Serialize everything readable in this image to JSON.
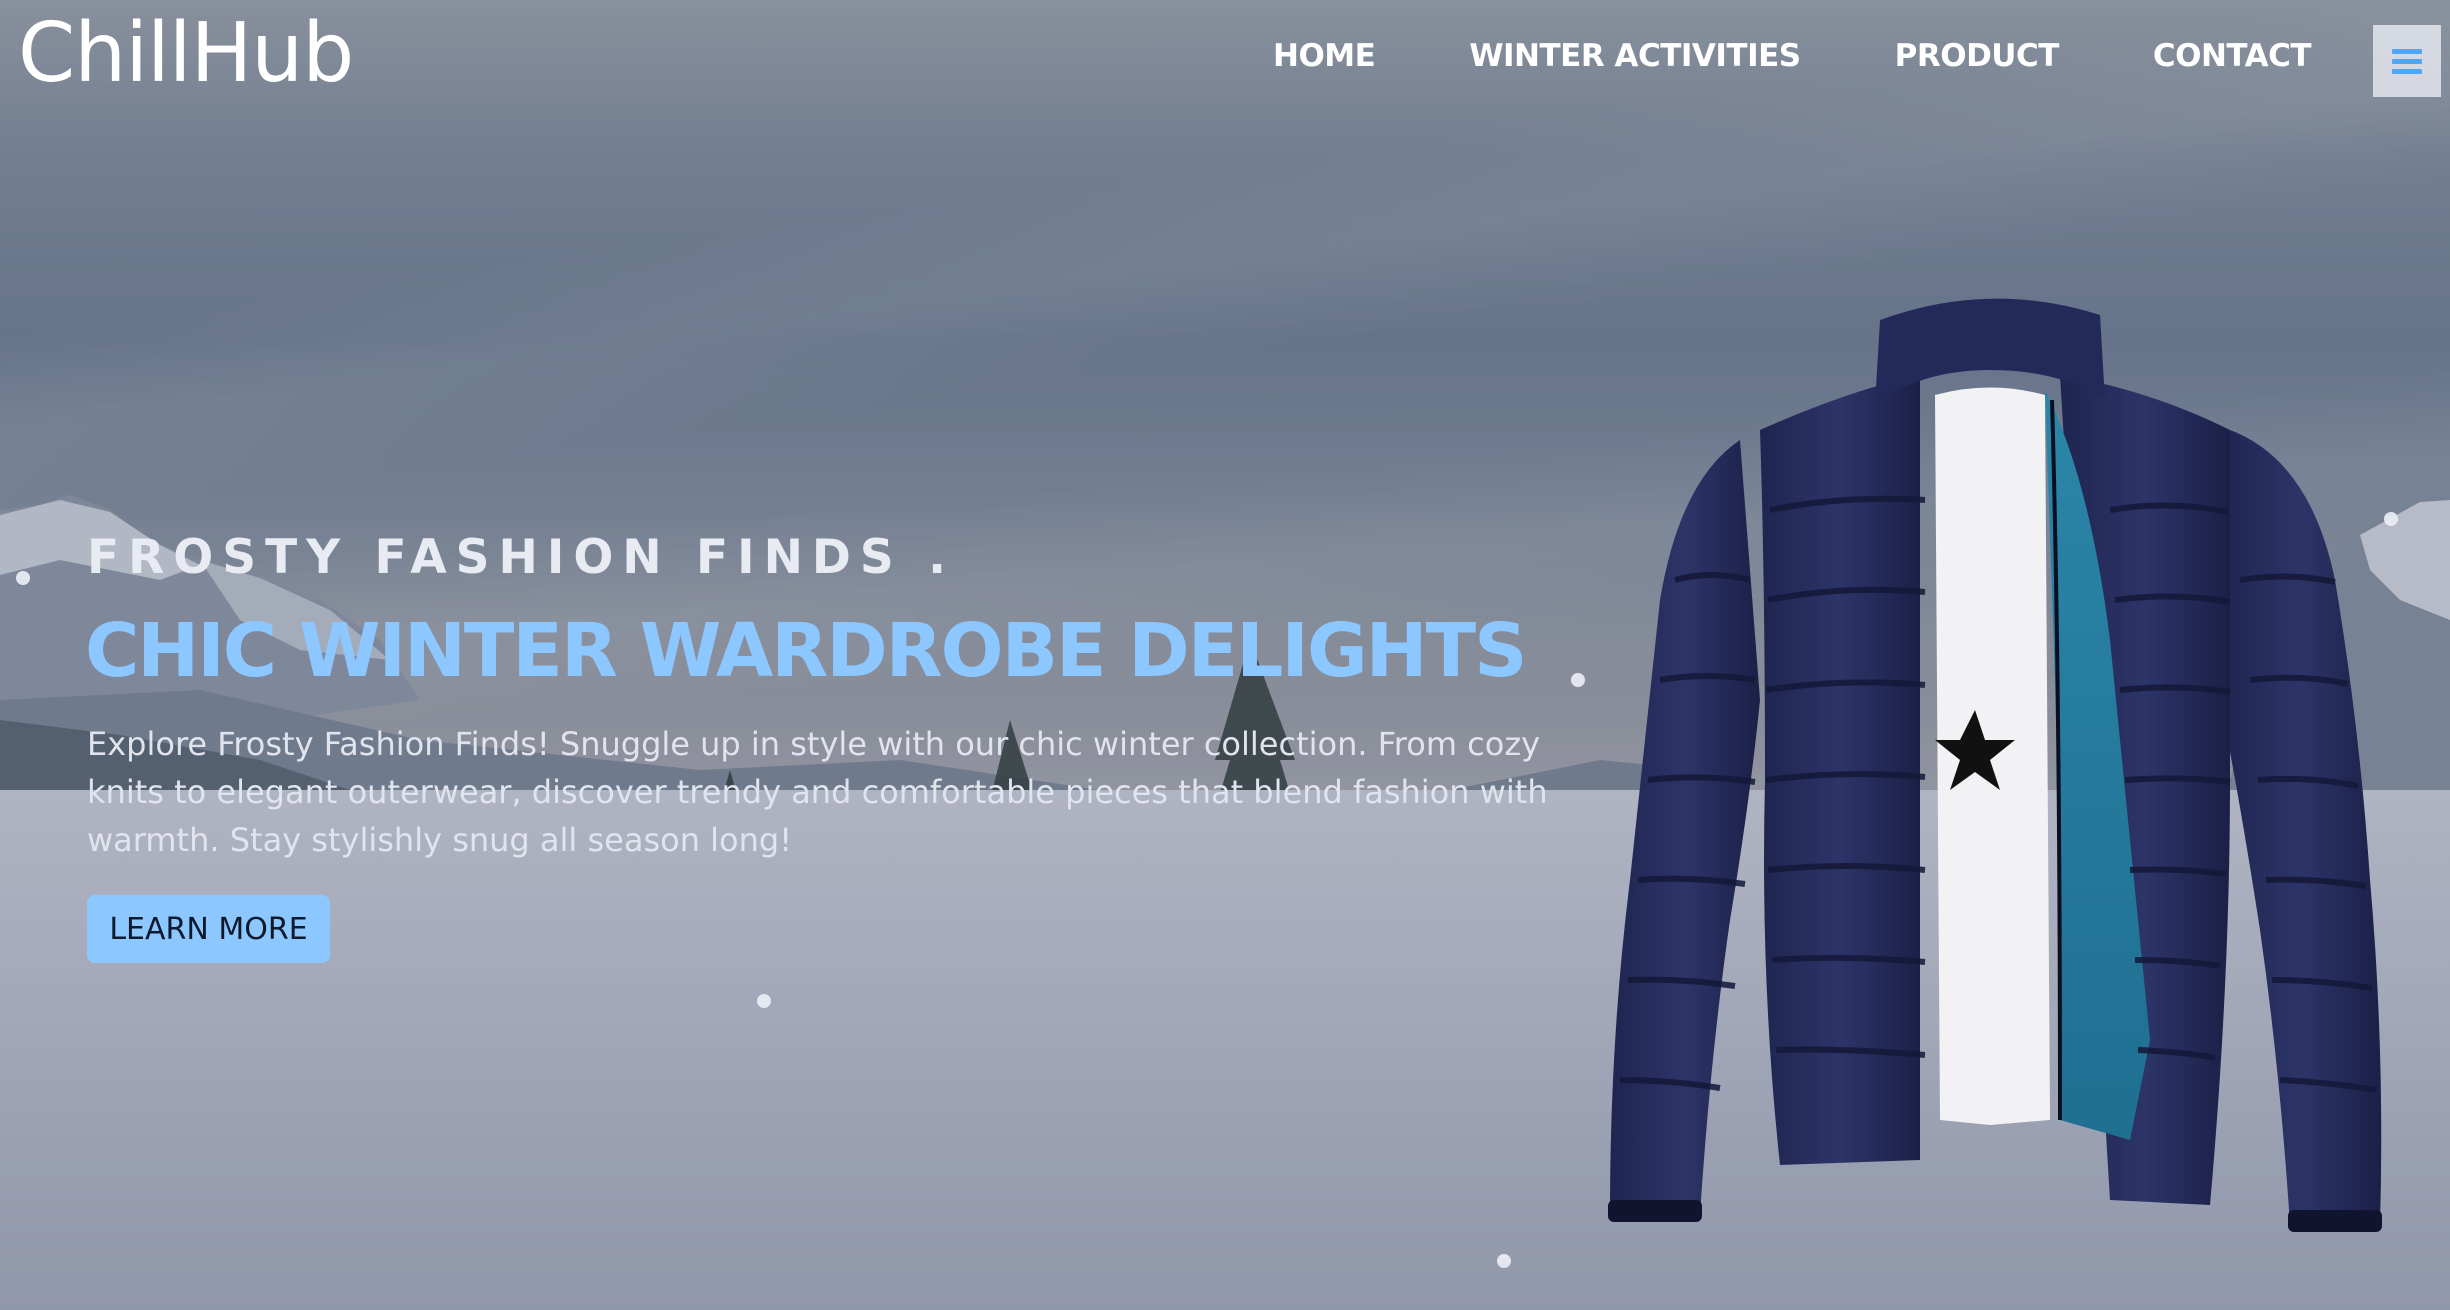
{
  "brand": {
    "logo": "ChillHub"
  },
  "nav": {
    "items": [
      "HOME",
      "WINTER ACTIVITIES",
      "PRODUCT",
      "CONTACT"
    ],
    "menu_icon": "hamburger-menu-icon"
  },
  "hero": {
    "kicker": "FROSTY FASHION FINDS .",
    "headline": "CHIC WINTER WARDROBE DELIGHTS",
    "description": "Explore Frosty Fashion Finds! Snuggle up in style with our chic winter collection. From cozy knits to elegant outerwear, discover trendy and comfortable pieces that blend fashion with warmth. Stay stylishly snug all season long!",
    "cta_label": "LEARN MORE",
    "product_image": "puffer-jacket-image"
  },
  "colors": {
    "accent": "#8cc7ff",
    "menu_icon": "#4ea6f5",
    "text": "#ffffff"
  }
}
